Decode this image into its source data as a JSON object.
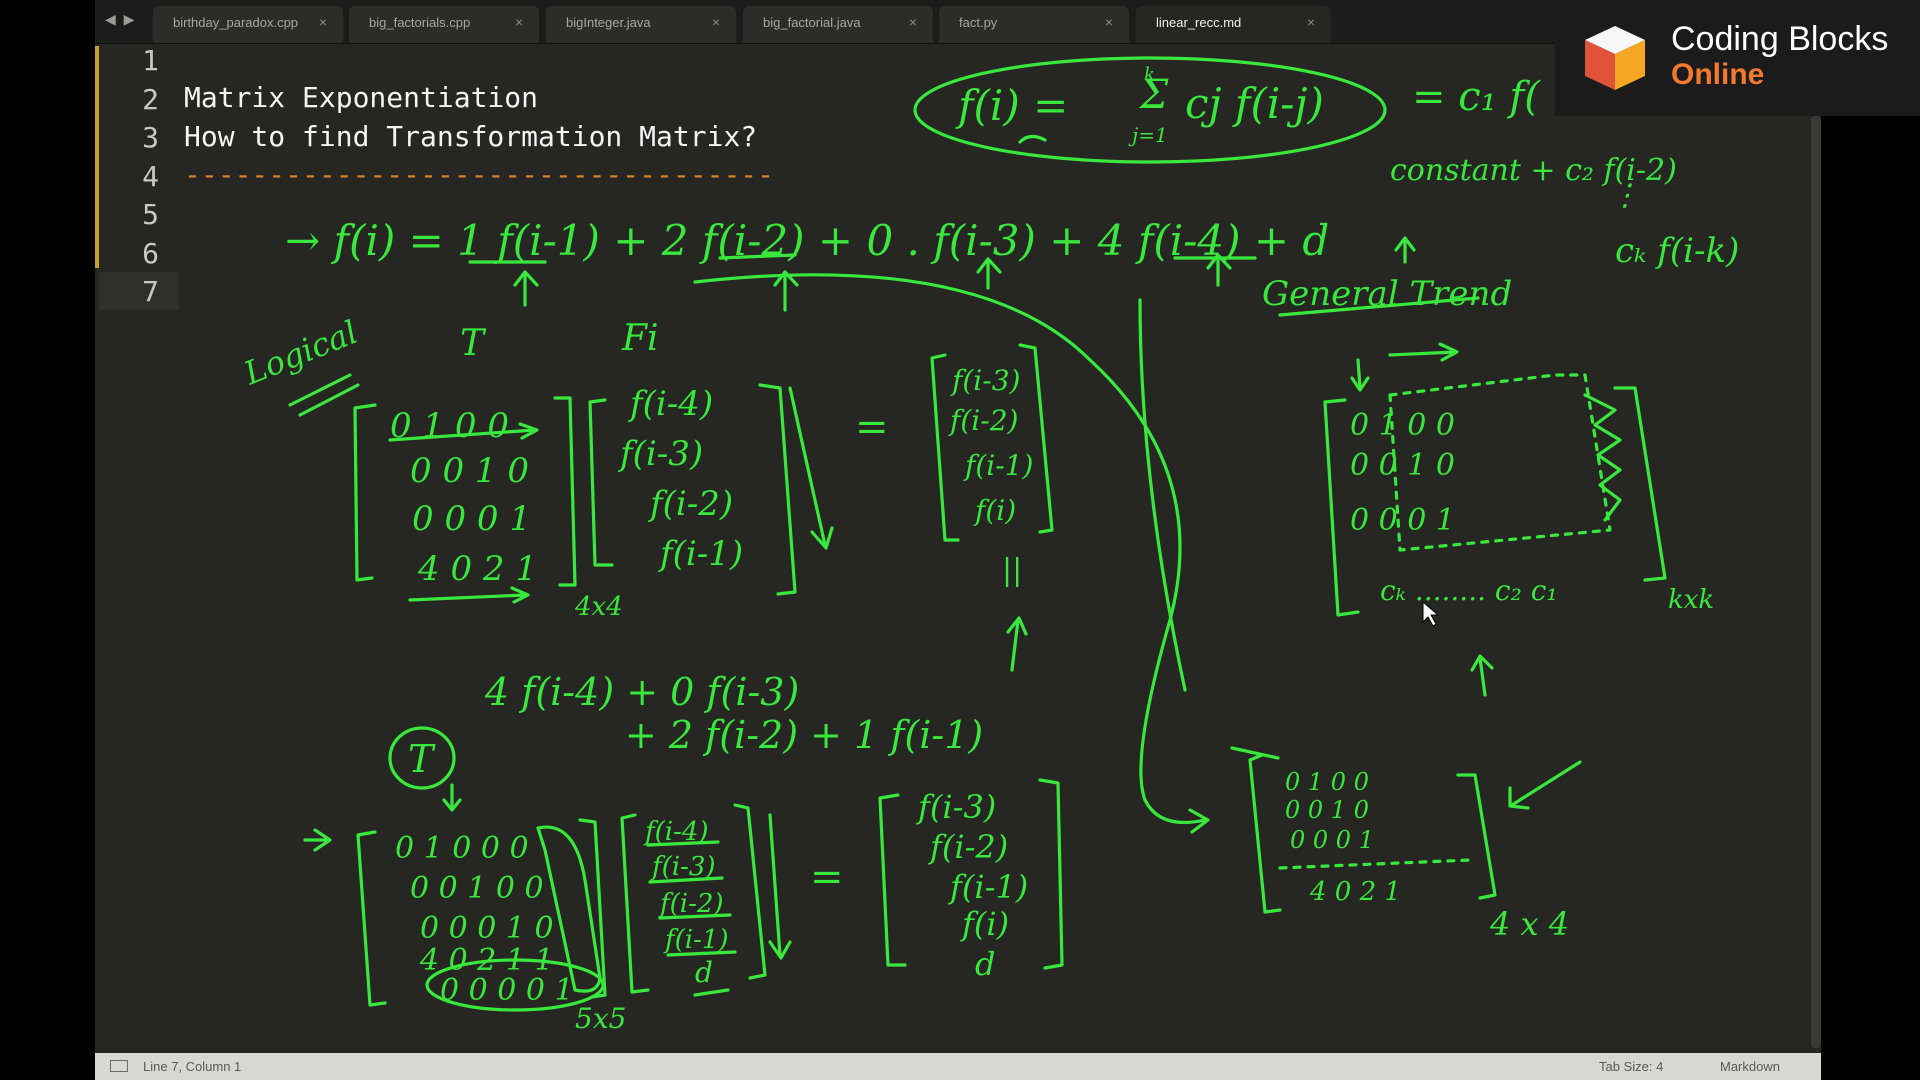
{
  "tabs": [
    {
      "label": "birthday_paradox.cpp",
      "active": false
    },
    {
      "label": "big_factorials.cpp",
      "active": false
    },
    {
      "label": "bigInteger.java",
      "active": false
    },
    {
      "label": "big_factorial.java",
      "active": false
    },
    {
      "label": "fact.py",
      "active": false
    },
    {
      "label": "linear_recc.md",
      "active": true
    }
  ],
  "tab_close_glyph": "×",
  "nav_arrows": "◀ ▶",
  "brand": {
    "line1": "Coding Blocks",
    "line2": "Online"
  },
  "editor": {
    "line_numbers": [
      "1",
      "2",
      "3",
      "4",
      "5",
      "6",
      "7"
    ],
    "lines": [
      "",
      "Matrix Exponentiation",
      "How to find Transformation Matrix?",
      "-----------------------------------",
      "",
      "",
      ""
    ]
  },
  "status": {
    "position": "Line 7, Column 1",
    "tab_size": "Tab Size: 4",
    "syntax": "Markdown"
  },
  "annotations": {
    "top_formula_lhs": "f(i) =",
    "top_formula_sum": "Σ",
    "top_formula_sum_top": "k",
    "top_formula_sum_bottom": "j=1",
    "top_formula_body": "cj f(i-j)",
    "top_formula_rhs": "= c₁ f(",
    "constant_note": "constant + c₂ f(i-2)",
    "ck_term": "cₖ f(i-k)",
    "recurrence": "→ f(i) = 1 f(i-1)  +  2 f(i-2)  +  0 . f(i-3)  +  4 f(i-4)  + d",
    "general_trend": "General Trend",
    "logical": "Logical",
    "T_label": "T",
    "Fi_label": "Fi",
    "matrix_T_rows": [
      "0 1 0 0",
      "0 0 1 0",
      "0 0 0 1",
      "4 0 2 1"
    ],
    "matrix_F_rows": [
      "f(i-4)",
      "f(i-3)",
      "f(i-2)",
      "f(i-1)"
    ],
    "result_rows": [
      "f(i-3)",
      "f(i-2)",
      "f(i-1)",
      "f(i)"
    ],
    "size_4x4": "4x4",
    "equals": "=",
    "parallel": "||",
    "expansion_line1": "4 f(i-4) + 0 f(i-3)",
    "expansion_line2": "+ 2 f(i-2) + 1 f(i-1)",
    "circled_T": "T",
    "matrix5_rows": [
      "0 1 0 0 0",
      "0 0 1 0 0",
      "0 0 0 1 0",
      "4 0 2 1 1",
      "0 0 0 0 1"
    ],
    "matrix5_F_rows": [
      "f(i-4)",
      "f(i-3)",
      "f(i-2)",
      "f(i-1)",
      "d"
    ],
    "result5_rows": [
      "f(i-3)",
      "f(i-2)",
      "f(i-1)",
      "f(i)",
      "d"
    ],
    "size_5x5": "5x5",
    "general_matrix_rows": [
      "0   1   0   0",
      "0   0   1   0",
      "0   0   0   1"
    ],
    "general_bottom": "cₖ ........ c₂  c₁",
    "size_kxk": "kxk",
    "small_matrix_rows": [
      "0 1 0 0",
      "0 0 1 0",
      "0 0 0 1",
      "4 0 2 1"
    ],
    "size_4x4_b": "4 x 4"
  }
}
